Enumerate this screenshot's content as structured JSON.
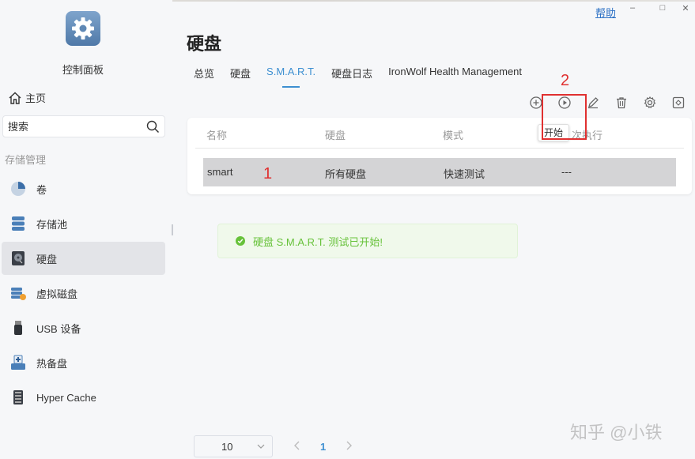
{
  "app": {
    "title": "控制面板",
    "page_title": "硬盘"
  },
  "window": {
    "help_label": "帮助",
    "minimize": "–",
    "maximize": "□",
    "close": "✕"
  },
  "sidebar": {
    "home_label": "主页",
    "search_placeholder": "搜索",
    "section_label": "存储管理",
    "items": [
      {
        "label": "卷",
        "icon": "volume-pie-icon"
      },
      {
        "label": "存储池",
        "icon": "storage-pool-icon"
      },
      {
        "label": "硬盘",
        "icon": "hard-disk-icon",
        "active": true
      },
      {
        "label": "虚拟磁盘",
        "icon": "virtual-disk-icon"
      },
      {
        "label": "USB 设备",
        "icon": "usb-icon"
      },
      {
        "label": "热备盘",
        "icon": "hot-spare-icon"
      },
      {
        "label": "Hyper Cache",
        "icon": "hyper-cache-icon"
      }
    ]
  },
  "tabs": [
    {
      "label": "总览"
    },
    {
      "label": "硬盘"
    },
    {
      "label": "S.M.A.R.T.",
      "active": true
    },
    {
      "label": "硬盘日志"
    },
    {
      "label": "IronWolf Health Management"
    }
  ],
  "toolbar": {
    "icons": [
      "add-circle-icon",
      "play-circle-icon",
      "edit-icon",
      "trash-icon",
      "gear-icon",
      "expand-icon"
    ],
    "tooltip": "开始"
  },
  "table": {
    "headers": [
      "名称",
      "硬盘",
      "模式",
      "次执行"
    ],
    "rows": [
      {
        "name": "smart",
        "disk": "所有硬盘",
        "mode": "快速测试",
        "last": "---"
      }
    ]
  },
  "toast": {
    "message": "硬盘 S.M.A.R.T. 测试已开始!"
  },
  "pagination": {
    "page_size": "10",
    "current_page": "1"
  },
  "annotations": {
    "mark1": "1",
    "mark2": "2"
  },
  "watermark": "知乎 @小铁",
  "colors": {
    "accent": "#3d8fd1",
    "success": "#67c23a",
    "annotation": "#e03030"
  }
}
